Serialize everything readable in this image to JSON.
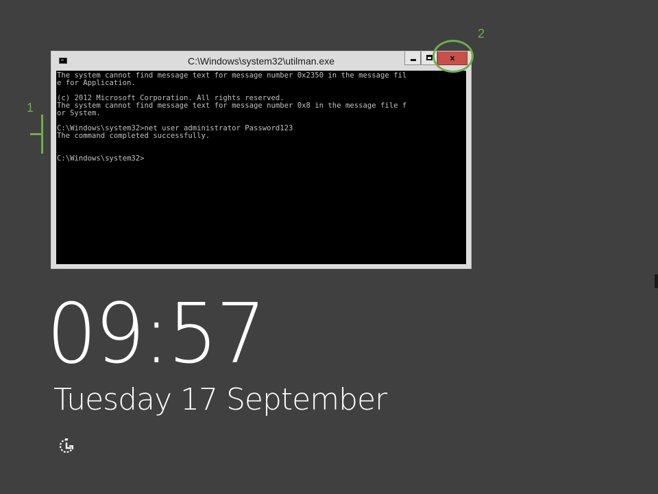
{
  "window": {
    "title": "C:\\Windows\\system32\\utilman.exe",
    "close_label": "x"
  },
  "console": {
    "text": "The system cannot find message text for message number 0x2350 in the message fil\ne for Application.\n\n(c) 2012 Microsoft Corporation. All rights reserved.\nThe system cannot find message text for message number 0x8 in the message file f\nor System.\n\nC:\\Windows\\system32>net user administrator Password123\nThe command completed successfully.\n\n\nC:\\Windows\\system32>"
  },
  "annotations": {
    "label_1": "1",
    "label_2": "2",
    "color": "#6fae4a"
  },
  "lockscreen": {
    "time": "09:57",
    "date": "Tuesday 17 September"
  },
  "icons": {
    "ease_of_access": "ease-of-access-icon",
    "console": "console-icon"
  },
  "colors": {
    "background": "#404040",
    "close_button": "#c9504a",
    "console_bg": "#000000",
    "console_fg": "#c0c0c0"
  }
}
